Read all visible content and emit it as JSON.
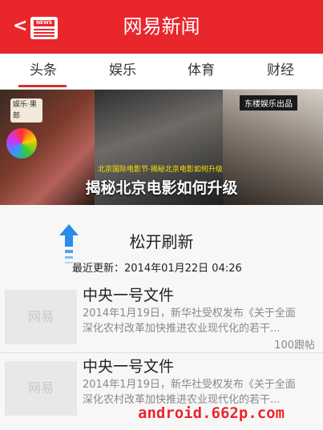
{
  "header": {
    "title": "网易新闻",
    "back_label": "<",
    "logo_text": "NEWS"
  },
  "tabs": [
    {
      "label": "头条",
      "active": true
    },
    {
      "label": "娱乐",
      "active": false
    },
    {
      "label": "体育",
      "active": false
    },
    {
      "label": "财经",
      "active": false
    }
  ],
  "banner": {
    "caption": "揭秘北京电影如何升级",
    "tag_left": "娱乐·果郎",
    "tag_right": "东楼娱乐出品",
    "sub_caption": "北京国际电影节·揭秘北京电影如何升级",
    "logo_left": "北京国际电影节"
  },
  "refresh": {
    "label": "松开刷新",
    "time": "最近更新：2014年01月22日 04:26"
  },
  "news": [
    {
      "title": "中央一号文件",
      "desc": "2014年1月19日，新华社受权发布《关于全面\n深化农村改革加快推进农业现代化的若干...",
      "replies": "100跟帖",
      "thumb": "网易"
    },
    {
      "title": "中央一号文件",
      "desc": "2014年1月19日，新华社受权发布《关于全面\n深化农村改革加快推进农业现代化的若干...",
      "replies": "",
      "thumb": "网易"
    }
  ],
  "watermark": "android.662p.com",
  "colors": {
    "brand": "#e8262c",
    "arrow": "#2a8be8"
  }
}
